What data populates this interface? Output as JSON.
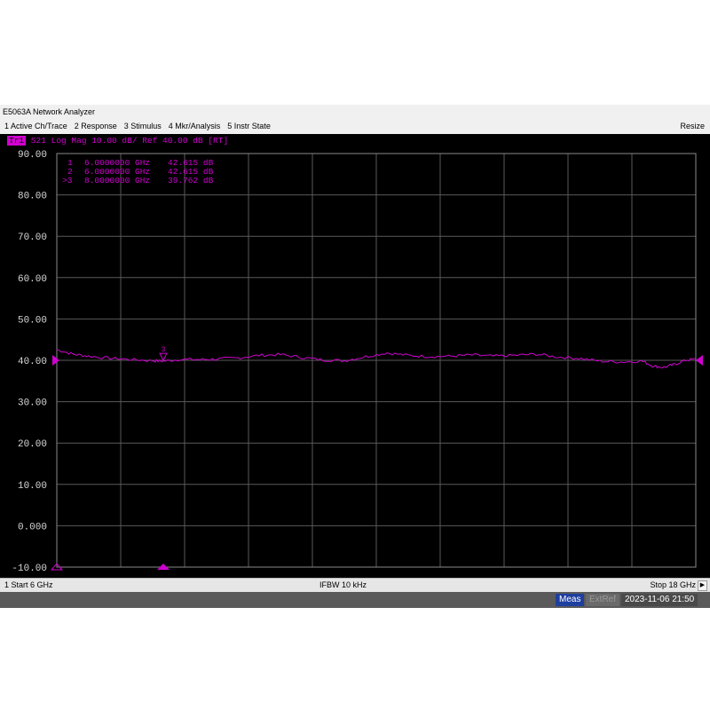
{
  "window": {
    "title": "E5063A Network Analyzer",
    "resize_label": "Resize"
  },
  "menu": {
    "items": [
      {
        "label": "1 Active Ch/Trace"
      },
      {
        "label": "2 Response"
      },
      {
        "label": "3 Stimulus"
      },
      {
        "label": "4 Mkr/Analysis"
      },
      {
        "label": "5 Instr State"
      }
    ]
  },
  "trace": {
    "tag": "Tr1",
    "header": " S21 Log Mag 10.00 dB/ Ref 40.00 dB [RT]",
    "color": "#d000d0"
  },
  "markers": [
    {
      "label": " 1",
      "freq": "6.0000000 GHz",
      "value": "42.615 dB"
    },
    {
      "label": " 2",
      "freq": "6.0000000 GHz",
      "value": "42.615 dB"
    },
    {
      "label": ">3",
      "freq": "8.0000000 GHz",
      "value": "39.762 dB"
    }
  ],
  "footer": {
    "start": "1  Start 6 GHz",
    "ifbw": "IFBW 10 kHz",
    "stop": "Stop 18 GHz",
    "scroll_icon": "arrow-right"
  },
  "status": {
    "meas": "Meas",
    "extref": "ExtRef",
    "datetime": "2023-11-06 21:50"
  },
  "chart_data": {
    "type": "line",
    "title": "S21 Log Mag 10.00 dB/ Ref 40.00 dB [RT]",
    "xlabel": "",
    "ylabel": "",
    "xlim": [
      6,
      18
    ],
    "ylim": [
      -10,
      90
    ],
    "grid": true,
    "y_ticks": [
      "90.00",
      "80.00",
      "70.00",
      "60.00",
      "50.00",
      "40.00",
      "30.00",
      "20.00",
      "10.00",
      "0.000",
      "-10.00"
    ],
    "y_tick_values": [
      90,
      80,
      70,
      60,
      50,
      40,
      30,
      20,
      10,
      0,
      -10
    ],
    "x_divisions": 10,
    "reference_level": 40,
    "marker_points": [
      {
        "label": "3",
        "x": 8.0,
        "y": 39.762
      }
    ],
    "series": [
      {
        "x": [
          6.0,
          6.3,
          6.6,
          7.0,
          7.4,
          7.8,
          8.0,
          8.3,
          8.7,
          9.0,
          9.4,
          9.8,
          10.2,
          10.6,
          11.0,
          11.4,
          11.8,
          12.2,
          12.6,
          13.0,
          13.4,
          13.8,
          14.2,
          14.6,
          15.0,
          15.4,
          15.8,
          16.2,
          16.6,
          17.0,
          17.2,
          17.4,
          17.6,
          17.8,
          18.0
        ],
        "y": [
          42.6,
          41.5,
          41.0,
          40.5,
          40.2,
          39.9,
          39.8,
          40.2,
          40.2,
          40.3,
          40.6,
          41.2,
          41.4,
          40.7,
          40.1,
          39.9,
          40.9,
          41.8,
          41.2,
          40.9,
          41.0,
          41.3,
          41.0,
          41.2,
          41.5,
          40.8,
          40.5,
          39.8,
          39.6,
          39.8,
          38.6,
          38.3,
          39.0,
          40.0,
          40.3
        ]
      }
    ]
  }
}
